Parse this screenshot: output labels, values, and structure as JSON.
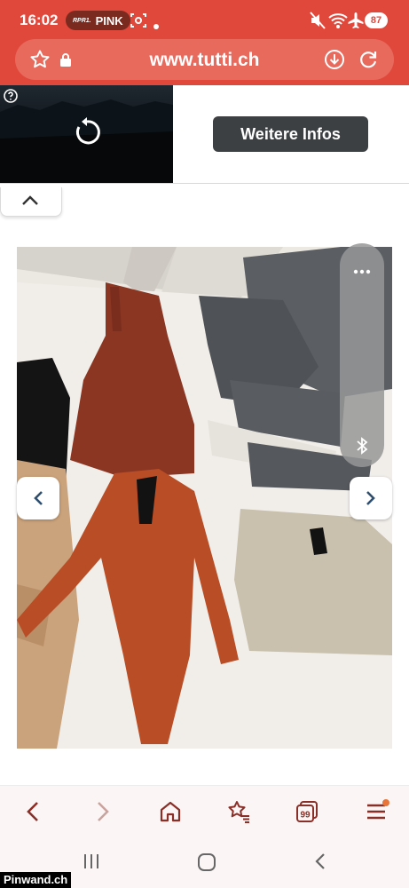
{
  "status_bar": {
    "time": "16:02",
    "radio_logo": "RPR1.",
    "radio_name": "PINK",
    "battery": "87"
  },
  "address_bar": {
    "url": "www.tutti.ch"
  },
  "ad": {
    "button_label": "Weitere Infos"
  },
  "watermark": "Pinwand.ch",
  "colors": {
    "brand": "#e0483c",
    "address_bg": "#e86a5d",
    "toolbar_icon": "#8a2f27",
    "notify_dot": "#e8743a"
  },
  "icons": {
    "status": [
      "screenshot-icon",
      "dot-icon",
      "mute-icon",
      "wifi-icon",
      "airplane-icon"
    ],
    "address": [
      "star-icon",
      "lock-icon",
      "download-icon",
      "reload-icon"
    ],
    "toolbar": [
      "back-icon",
      "forward-icon",
      "home-icon",
      "bookmarks-icon",
      "tabs-icon",
      "menu-icon"
    ],
    "system": [
      "recents-icon",
      "home-circle-icon",
      "back-chevron-icon"
    ]
  }
}
